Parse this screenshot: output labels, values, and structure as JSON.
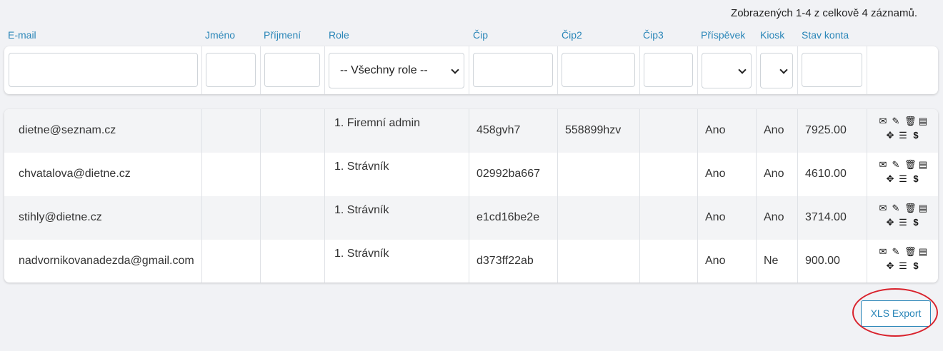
{
  "summary": "Zobrazených 1-4 z celkově 4 záznamů.",
  "columns": {
    "email": "E-mail",
    "jmeno": "Jméno",
    "prijmeni": "Příjmení",
    "role": "Role",
    "cip": "Čip",
    "cip2": "Čip2",
    "cip3": "Čip3",
    "prispevek": "Příspěvek",
    "kiosk": "Kiosk",
    "stav": "Stav konta"
  },
  "filters": {
    "role_selected": "-- Všechny role --"
  },
  "rows": [
    {
      "email": "dietne@seznam.cz",
      "jmeno": "",
      "prijmeni": "",
      "role": "1. Firemní admin",
      "cip": "458gvh7",
      "cip2": "558899hzv",
      "cip3": "",
      "prispevek": "Ano",
      "kiosk": "Ano",
      "stav": "7925.00"
    },
    {
      "email": "chvatalova@dietne.cz",
      "jmeno": "",
      "prijmeni": "",
      "role": "1. Strávník",
      "cip": "02992ba667",
      "cip2": "",
      "cip3": "",
      "prispevek": "Ano",
      "kiosk": "Ano",
      "stav": "4610.00"
    },
    {
      "email": "stihly@dietne.cz",
      "jmeno": "",
      "prijmeni": "",
      "role": "1. Strávník",
      "cip": "e1cd16be2e",
      "cip2": "",
      "cip3": "",
      "prispevek": "Ano",
      "kiosk": "Ano",
      "stav": "3714.00"
    },
    {
      "email": "nadvornikovanadezda@gmail.com",
      "jmeno": "",
      "prijmeni": "",
      "role": "1. Strávník",
      "cip": "d373ff22ab",
      "cip2": "",
      "cip3": "",
      "prispevek": "Ano",
      "kiosk": "Ne",
      "stav": "900.00"
    }
  ],
  "row_actions": {
    "icons": [
      "envelope-icon",
      "pencil-icon",
      "trash-icon",
      "list-icon",
      "move-icon",
      "menu-icon",
      "dollar-icon"
    ],
    "glyphs": {
      "envelope": "✉",
      "pencil": "✎",
      "trash": "🗑",
      "list": "▤",
      "move": "✥",
      "menu": "☰",
      "dollar": "$"
    }
  },
  "export_button": "XLS Export",
  "colors": {
    "accent": "#2a86b8",
    "highlight_circle": "#d9232d",
    "row_alt": "#f3f4f6",
    "background": "#f1f2f5"
  }
}
